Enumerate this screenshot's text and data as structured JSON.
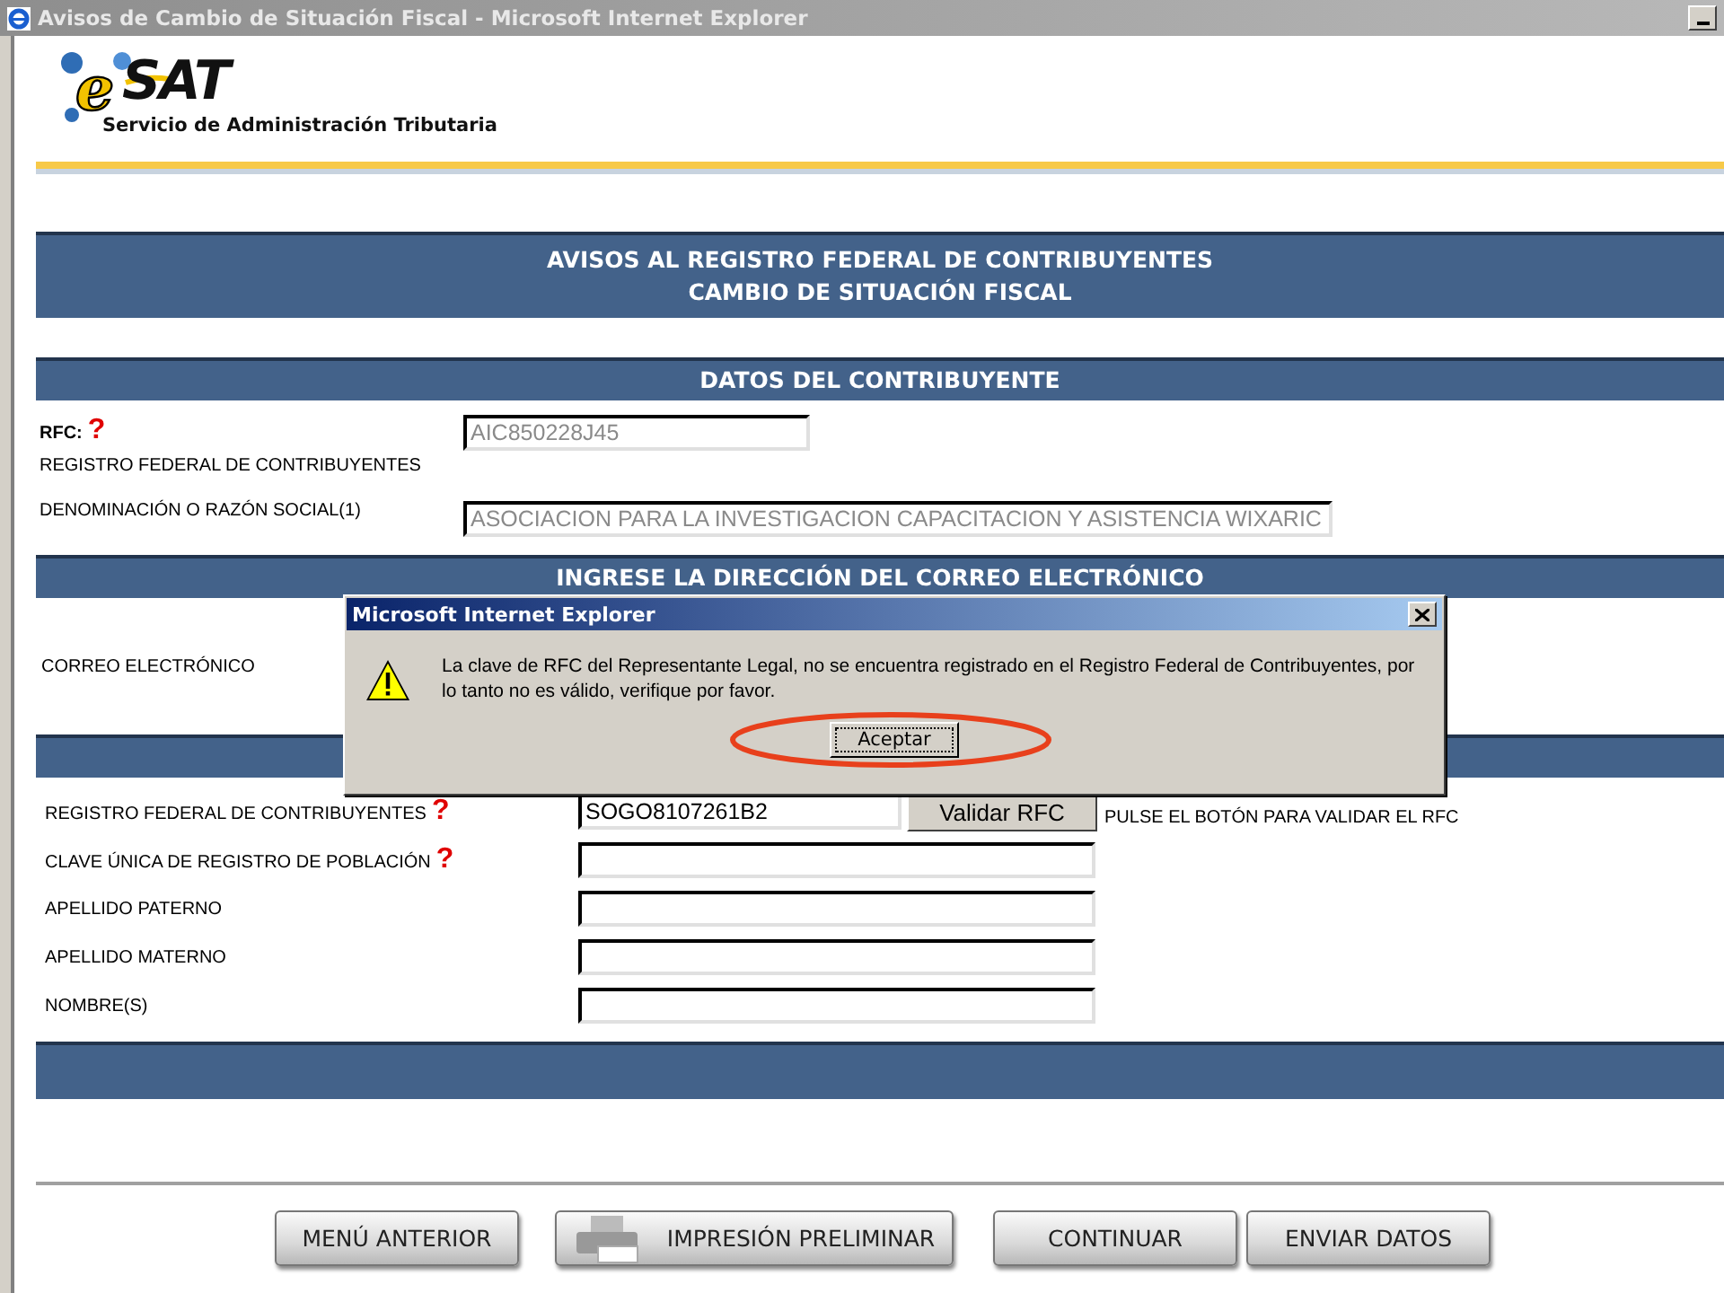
{
  "window": {
    "title": "Avisos de Cambio de Situación Fiscal - Microsoft Internet Explorer"
  },
  "logo": {
    "letter": "e",
    "wordmark": "SAT",
    "subtitle": "Servicio de Administración Tributaria"
  },
  "banner": {
    "lines": [
      "AVISOS AL REGISTRO FEDERAL DE CONTRIBUYENTES",
      "CAMBIO DE SITUACIÓN FISCAL"
    ]
  },
  "contribuyente": {
    "title": "DATOS DEL CONTRIBUYENTE",
    "rfc_label": "RFC:",
    "help": "?",
    "rfc_sublabel": "REGISTRO FEDERAL DE CONTRIBUYENTES",
    "rfc_value": "AIC850228J45",
    "razon_label": "DENOMINACIÓN O RAZÓN SOCIAL(1)",
    "razon_value": "ASOCIACION PARA LA INVESTIGACION CAPACITACION Y ASISTENCIA WIXARIC"
  },
  "correo": {
    "title": "INGRESE LA DIRECCIÓN DEL CORREO ELECTRÓNICO",
    "label": "CORREO ELECTRÓNICO"
  },
  "representante": {
    "rows": [
      {
        "label": "REGISTRO FEDERAL DE CONTRIBUYENTES",
        "help": "?",
        "value": "SOGO8107261B2",
        "button": "Validar RFC",
        "note": "PULSE EL BOTÓN PARA VALIDAR EL RFC"
      },
      {
        "label": "CLAVE ÚNICA DE REGISTRO DE POBLACIÓN",
        "help": "?"
      },
      {
        "label": "APELLIDO PATERNO"
      },
      {
        "label": "APELLIDO MATERNO"
      },
      {
        "label": "NOMBRE(S)"
      }
    ]
  },
  "footer_buttons": [
    {
      "label": "MENÚ ANTERIOR",
      "kind": "plain"
    },
    {
      "label": "IMPRESIÓN PRELIMINAR",
      "kind": "print"
    },
    {
      "label": "CONTINUAR",
      "kind": "plain"
    },
    {
      "label": "ENVIAR DATOS",
      "kind": "plain"
    }
  ],
  "dialog": {
    "title": "Microsoft Internet Explorer",
    "message": "La clave de RFC del Representante Legal, no se encuentra registrado en el Registro Federal de Contribuyentes, por lo tanto no es válido, verifique por favor.",
    "button": "Aceptar",
    "highlighted": true
  }
}
